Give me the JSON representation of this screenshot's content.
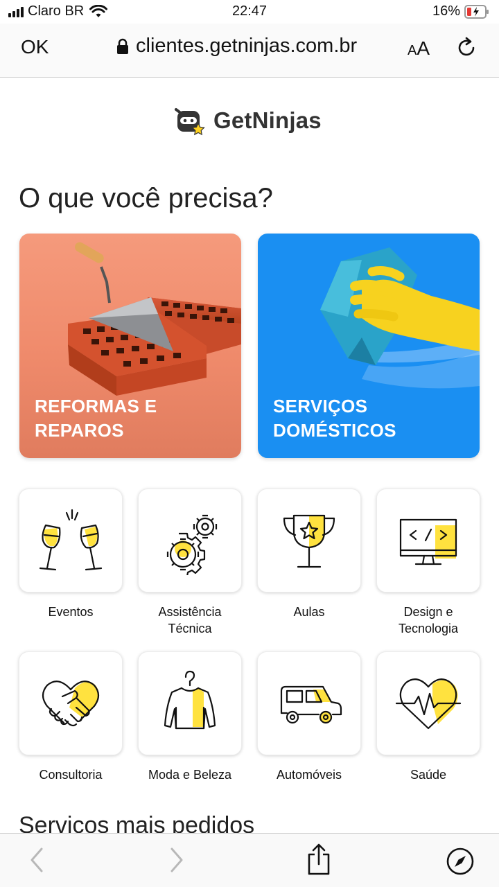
{
  "status_bar": {
    "carrier": "Claro BR",
    "time": "22:47",
    "battery": "16%"
  },
  "browser": {
    "done_label": "OK",
    "url": "clientes.getninjas.com.br",
    "text_size_small": "A",
    "text_size_large": "A"
  },
  "logo": {
    "text": "GetNinjas"
  },
  "heading": "O que você precisa?",
  "featured": [
    {
      "label": "REFORMAS E\nREPAROS"
    },
    {
      "label": "SERVIÇOS\nDOMÉSTICOS"
    }
  ],
  "categories": [
    {
      "label": "Eventos",
      "icon": "champagne-glasses-icon"
    },
    {
      "label": "Assistência\nTécnica",
      "icon": "gears-icon"
    },
    {
      "label": "Aulas",
      "icon": "trophy-icon"
    },
    {
      "label": "Design e\nTecnologia",
      "icon": "monitor-code-icon"
    },
    {
      "label": "Consultoria",
      "icon": "handshake-icon"
    },
    {
      "label": "Moda e Beleza",
      "icon": "shirt-hanger-icon"
    },
    {
      "label": "Automóveis",
      "icon": "car-icon"
    },
    {
      "label": "Saúde",
      "icon": "heart-pulse-icon"
    }
  ],
  "section_title": "Serviços mais pedidos",
  "colors": {
    "accent_yellow": "#ffe23f",
    "reform": "#ef8a6b",
    "domestic": "#1a8ff2"
  }
}
